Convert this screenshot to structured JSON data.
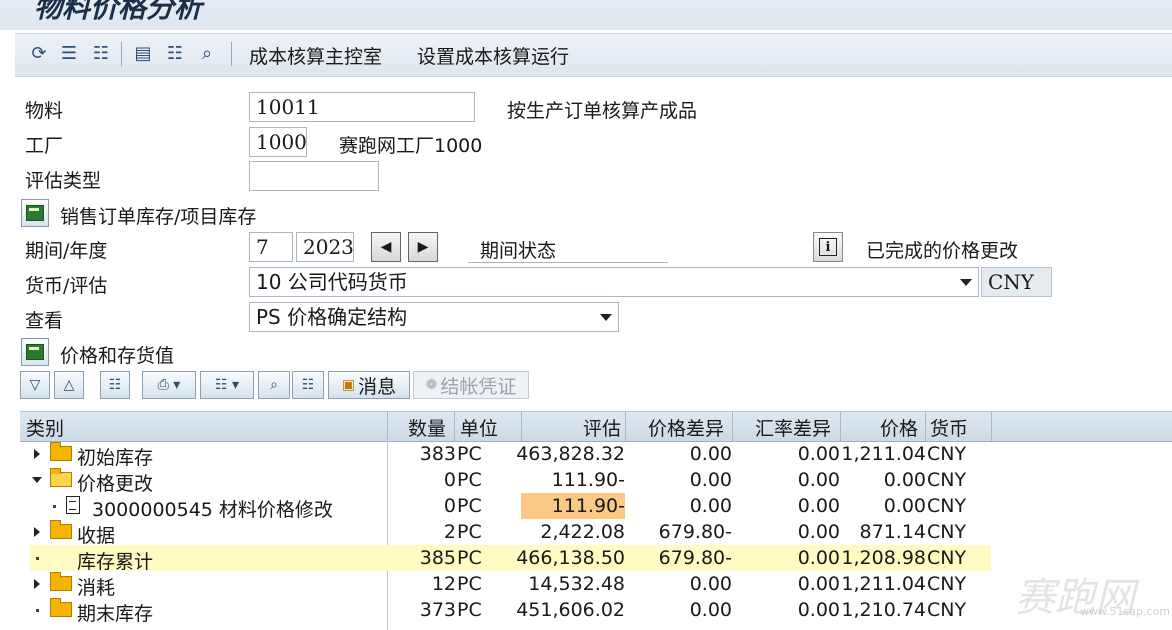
{
  "window": {
    "title": "物料价格分析"
  },
  "toolbar": {
    "btn_cost_center": "成本核算主控室",
    "btn_setup_run": "设置成本核算运行"
  },
  "form": {
    "material_label": "物料",
    "material_value": "10011",
    "material_desc": "按生产订单核算产成品",
    "plant_label": "工厂",
    "plant_value": "1000",
    "plant_desc": "赛跑网工厂1000",
    "valtype_label": "评估类型",
    "valtype_value": "",
    "sales_stock_label": "销售订单库存/项目库存",
    "period_label": "期间/年度",
    "period_value": "7",
    "year_value": "2023",
    "period_status_label": "期间状态",
    "price_change_status": "已完成的价格更改",
    "currency_label": "货币/评估",
    "currency_value": "10 公司代码货币",
    "currency_code": "CNY",
    "view_label": "查看",
    "view_value": "PS 价格确定结构",
    "price_stock_label": "价格和存货值"
  },
  "alv": {
    "msg_label": "消息",
    "posting_doc_label": "结帐凭证"
  },
  "grid": {
    "headers": {
      "category": "类别",
      "qty": "数量",
      "unit": "单位",
      "valuation": "评估",
      "price_diff": "价格差异",
      "fx_diff": "汇率差异",
      "price": "价格",
      "currency": "货币"
    },
    "rows": [
      {
        "category": "初始库存",
        "qty": "383",
        "unit": "PC",
        "valuation": "463,828.32",
        "price_diff": "0.00",
        "fx_diff": "0.00",
        "price": "1,211.04",
        "currency": "CNY"
      },
      {
        "category": "价格更改",
        "qty": "0",
        "unit": "PC",
        "valuation": "111.90-",
        "price_diff": "0.00",
        "fx_diff": "0.00",
        "price": "0.00",
        "currency": "CNY"
      },
      {
        "category": "3000000545 材料价格修改",
        "qty": "0",
        "unit": "PC",
        "valuation": "111.90-",
        "price_diff": "0.00",
        "fx_diff": "0.00",
        "price": "0.00",
        "currency": "CNY"
      },
      {
        "category": "收据",
        "qty": "2",
        "unit": "PC",
        "valuation": "2,422.08",
        "price_diff": "679.80-",
        "fx_diff": "0.00",
        "price": "871.14",
        "currency": "CNY"
      },
      {
        "category": "库存累计",
        "qty": "385",
        "unit": "PC",
        "valuation": "466,138.50",
        "price_diff": "679.80-",
        "fx_diff": "0.00",
        "price": "1,208.98",
        "currency": "CNY"
      },
      {
        "category": "消耗",
        "qty": "12",
        "unit": "PC",
        "valuation": "14,532.48",
        "price_diff": "0.00",
        "fx_diff": "0.00",
        "price": "1,211.04",
        "currency": "CNY"
      },
      {
        "category": "期末库存",
        "qty": "373",
        "unit": "PC",
        "valuation": "451,606.02",
        "price_diff": "0.00",
        "fx_diff": "0.00",
        "price": "1,210.74",
        "currency": "CNY"
      }
    ]
  },
  "watermark": {
    "text": "赛跑网",
    "sub": "www.51sap.com"
  }
}
